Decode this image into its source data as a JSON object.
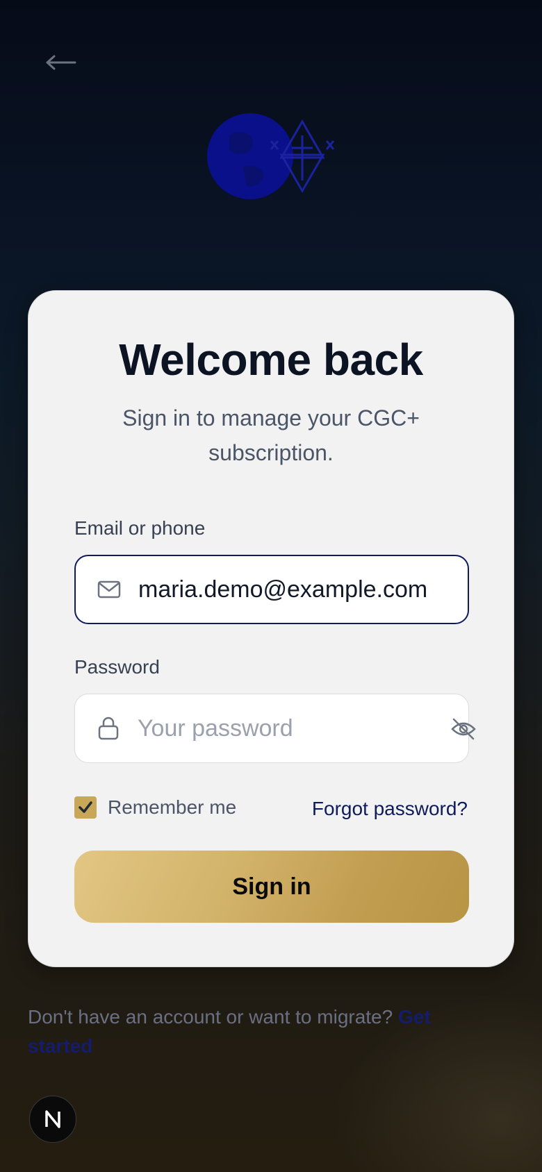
{
  "nav": {
    "back_icon": "arrow-left-icon"
  },
  "logo": {
    "icon": "globe-star-cross-logo"
  },
  "card": {
    "title": "Welcome back",
    "subtitle": "Sign in to manage your CGC+ subscription."
  },
  "form": {
    "email_label": "Email or phone",
    "email_value": "maria.demo@example.com",
    "password_label": "Password",
    "password_placeholder": "Your password",
    "remember_label": "Remember me",
    "remember_checked": true,
    "forgot_link": "Forgot password?",
    "submit_label": "Sign in"
  },
  "footer": {
    "prompt": "Don't have an account or want to migrate?",
    "link": "Get started"
  },
  "badge": {
    "label": "N"
  },
  "colors": {
    "accent_gold": "#c8a858",
    "link_navy": "#0f1a5c",
    "title": "#0c1424",
    "card_bg": "#f2f2f2"
  }
}
